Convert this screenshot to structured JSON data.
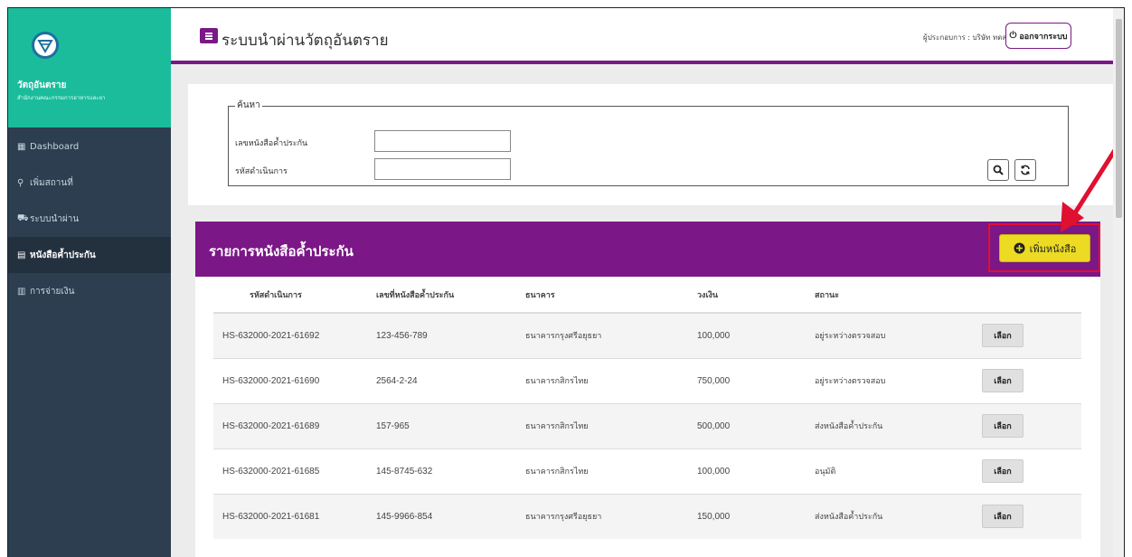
{
  "brand": {
    "title": "วัตถุอันตราย",
    "subtitle": "สำนักงานคณะกรรมการอาหารและยา"
  },
  "sidebar": {
    "items": [
      {
        "label": "Dashboard",
        "icon": "dashboard-icon"
      },
      {
        "label": "เพิ่มสถานที่",
        "icon": "map-marker-icon"
      },
      {
        "label": "ระบบนำผ่าน",
        "icon": "truck-icon"
      },
      {
        "label": "หนังสือค้ำประกัน",
        "icon": "book-icon",
        "active": true
      },
      {
        "label": "การจ่ายเงิน",
        "icon": "money-icon"
      }
    ]
  },
  "header": {
    "title": "ระบบนำผ่านวัตถุอันตราย",
    "operator": "ผู้ประกอบการ : บริษัท ทดสอบ จำกัด",
    "logout": "ออกจากระบบ"
  },
  "search": {
    "legend": "ค้นหา",
    "guarantee_label": "เลขหนังสือค้ำประกัน",
    "code_label": "รหัสดำเนินการ",
    "guarantee_value": "",
    "code_value": ""
  },
  "list": {
    "title": "รายการหนังสือค้ำประกัน",
    "add_button": "เพิ่มหนังสือ",
    "columns": [
      "รหัสดำเนินการ",
      "เลขที่หนังสือค้ำประกัน",
      "ธนาคาร",
      "วงเงิน",
      "สถานะ",
      ""
    ],
    "rows": [
      {
        "code": "HS-632000-2021-61692",
        "guarantee": "123-456-789",
        "bank": "ธนาคารกรุงศรีอยุธยา",
        "amount": "100,000",
        "status": "อยู่ระหว่างตรวจสอบ",
        "action": "เลือก"
      },
      {
        "code": "HS-632000-2021-61690",
        "guarantee": "2564-2-24",
        "bank": "ธนาคารกสิกรไทย",
        "amount": "750,000",
        "status": "อยู่ระหว่างตรวจสอบ",
        "action": "เลือก"
      },
      {
        "code": "HS-632000-2021-61689",
        "guarantee": "157-965",
        "bank": "ธนาคารกสิกรไทย",
        "amount": "500,000",
        "status": "ส่งหนังสือค้ำประกัน",
        "action": "เลือก"
      },
      {
        "code": "HS-632000-2021-61685",
        "guarantee": "145-8745-632",
        "bank": "ธนาคารกสิกรไทย",
        "amount": "100,000",
        "status": "อนุมัติ",
        "action": "เลือก"
      },
      {
        "code": "HS-632000-2021-61681",
        "guarantee": "145-9966-854",
        "bank": "ธนาคารกรุงศรีอยุธยา",
        "amount": "150,000",
        "status": "ส่งหนังสือค้ำประกัน",
        "action": "เลือก"
      }
    ]
  },
  "colors": {
    "primary": "#7b1787",
    "sidebar": "#2c3e50",
    "brand": "#1abc9c",
    "add_button": "#ecdb22",
    "annotation": "#e01030"
  }
}
